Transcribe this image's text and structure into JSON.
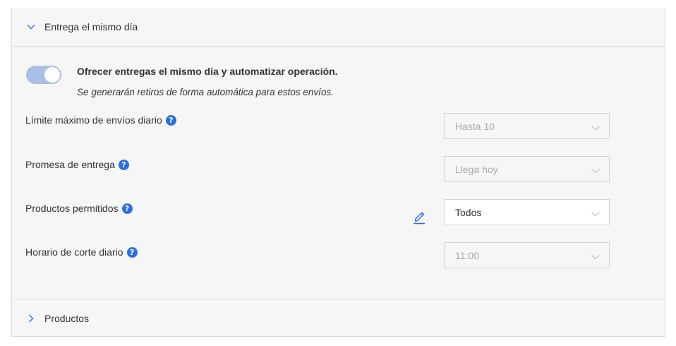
{
  "same_day_section": {
    "title": "Entrega el mismo día",
    "expanded": true
  },
  "offer": {
    "enabled": true,
    "title": "Ofrecer entregas el mismo día y automatizar operación.",
    "subtitle": "Se generarán retiros de forma automática para estos envíos."
  },
  "fields": {
    "daily_limit": {
      "label": "Límite máximo de envíos diario",
      "value": "Hasta 10",
      "disabled": true
    },
    "delivery_promise": {
      "label": "Promesa de entrega",
      "value": "Llega hoy",
      "disabled": true
    },
    "allowed_products": {
      "label": "Productos permitidos",
      "value": "Todos",
      "disabled": false
    },
    "cutoff_time": {
      "label": "Horario de corte diario",
      "value": "11:00",
      "disabled": true
    }
  },
  "help_glyph": "?",
  "products_section": {
    "title": "Productos",
    "expanded": false
  },
  "icons": {
    "section_expanded": "chevron-down-icon",
    "section_collapsed": "chevron-right-icon",
    "help": "question-circle-icon",
    "edit": "pencil-icon",
    "select": "chevron-down-icon"
  },
  "colors": {
    "accent": "#2d6fe6",
    "toggle_track": "#a9c0e4",
    "panel_bg": "#f6f6f6",
    "border": "#dcdcdc",
    "disabled_text": "#a8a8a8"
  }
}
